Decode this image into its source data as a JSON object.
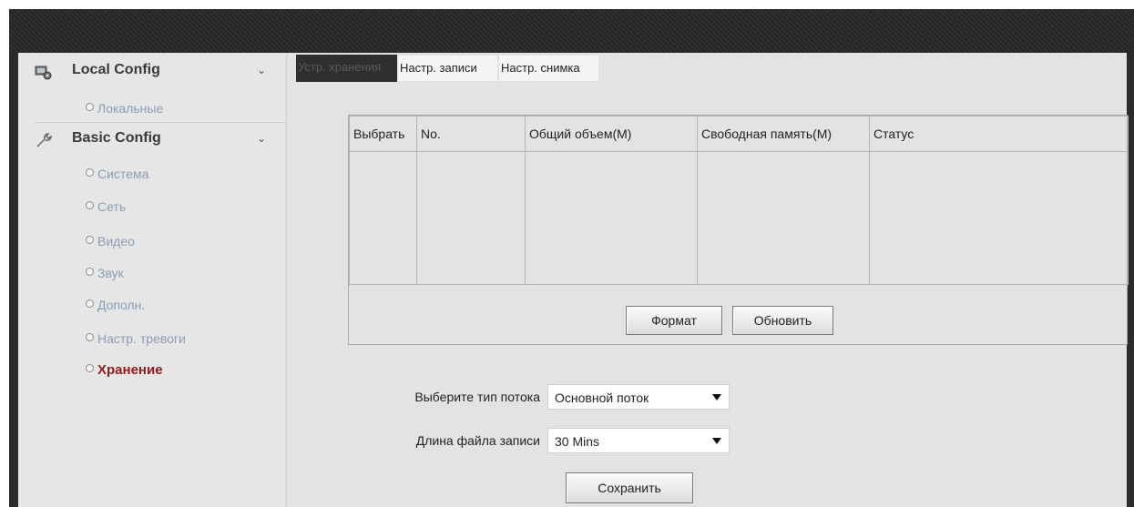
{
  "sidebar": {
    "local_config": {
      "title": "Local Config",
      "items": [
        {
          "label": "Локальные"
        }
      ]
    },
    "basic_config": {
      "title": "Basic Config",
      "items": [
        {
          "label": "Система"
        },
        {
          "label": "Сеть"
        },
        {
          "label": "Видео"
        },
        {
          "label": "Звук"
        },
        {
          "label": "Дополн."
        },
        {
          "label": "Настр. тревоги"
        },
        {
          "label": "Хранение"
        }
      ],
      "active_item": "Хранение"
    }
  },
  "tabs": [
    {
      "label": "Устр. хранения",
      "active": true
    },
    {
      "label": "Настр. записи",
      "active": false
    },
    {
      "label": "Настр. снимка",
      "active": false
    }
  ],
  "disk_table": {
    "columns": [
      "Выбрать",
      "No.",
      "Общий объем(M)",
      "Свободная память(M)",
      "Статус"
    ],
    "rows": []
  },
  "buttons": {
    "format": "Формат",
    "refresh": "Обновить",
    "save": "Сохранить"
  },
  "form": {
    "stream_type": {
      "label": "Выберите тип потока",
      "value": "Основной поток"
    },
    "record_length": {
      "label": "Длина файла записи",
      "value": "30 Mins"
    }
  },
  "colors": {
    "active_nav": "#8e1b1b",
    "nav_link": "#8b9db3",
    "active_tab_bg": "#2f2f2f",
    "content_bg": "#e3e3e3"
  }
}
